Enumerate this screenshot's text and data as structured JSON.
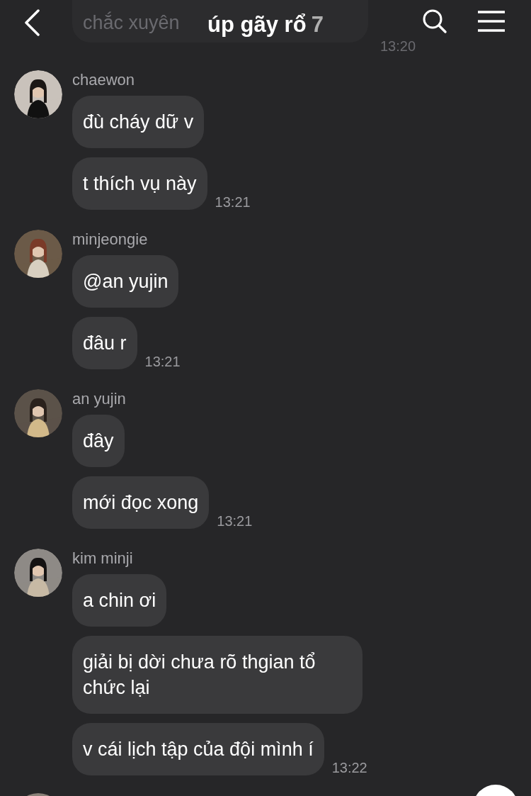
{
  "header": {
    "title": "úp gãy rổ",
    "member_count": "7"
  },
  "faded_message": {
    "text": "chắc xuyên",
    "time": "13:20"
  },
  "groups": [
    {
      "name": "chaewon",
      "messages": [
        "đù cháy dữ v",
        "t thích vụ này"
      ],
      "time": "13:21"
    },
    {
      "name": "minjeongie",
      "messages": [
        "@an yujin",
        "đâu r"
      ],
      "time": "13:21"
    },
    {
      "name": "an yujin",
      "messages": [
        "đây",
        "mới đọc xong"
      ],
      "time": "13:21"
    },
    {
      "name": "kim minji",
      "messages": [
        "a chin ơi",
        "giải bị dời chưa rõ thgian tổ chức lại",
        "v cái lịch tập của đội mình í"
      ],
      "time": "13:22"
    }
  ]
}
